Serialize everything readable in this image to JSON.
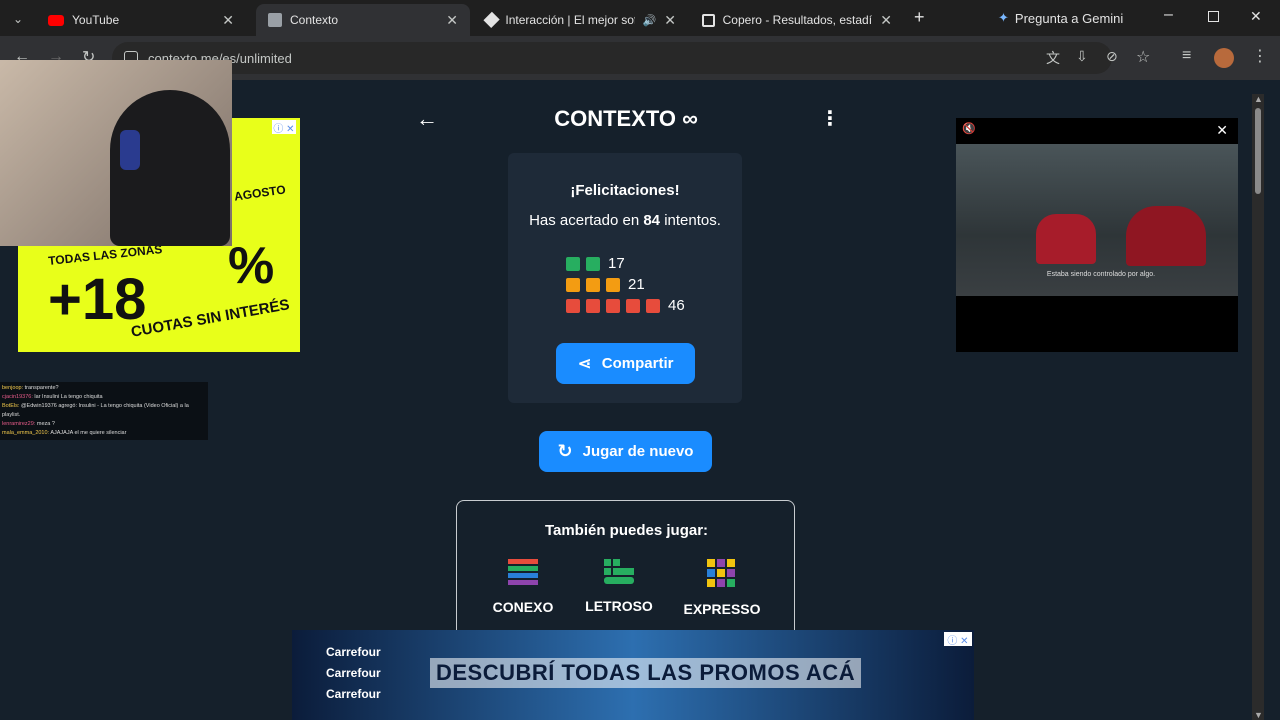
{
  "tabs": [
    {
      "title": "YouTube",
      "icon": "youtube-icon"
    },
    {
      "title": "Contexto",
      "icon": "contexto-favicon-icon"
    },
    {
      "title": "Interacción | El mejor softw",
      "icon": "tab-app-icon"
    },
    {
      "title": "Copero - Resultados, estadístic",
      "icon": "tab-app-icon"
    }
  ],
  "gemini_label": "Pregunta a Gemini",
  "url": "contexto.me/es/unlimited",
  "header": {
    "title": "CONTEXTO ∞"
  },
  "result": {
    "heading": "¡Felicitaciones!",
    "summary_prefix": "Has acertado en ",
    "attempts": "84",
    "summary_suffix": " intentos.",
    "rows": [
      {
        "count": "17",
        "squares": 2,
        "color": "#27ae60"
      },
      {
        "count": "21",
        "squares": 3,
        "color": "#f39c12"
      },
      {
        "count": "46",
        "squares": 5,
        "color": "#e74c3c"
      }
    ],
    "share_label": "Compartir"
  },
  "play_again_label": "Jugar de nuevo",
  "also_play": {
    "heading": "También puedes jugar:",
    "games": [
      {
        "name": "CONEXO"
      },
      {
        "name": "LETROSO"
      },
      {
        "name": "EXPRESSO"
      }
    ]
  },
  "bottom_ad": {
    "brand_lines": [
      "Carrefour",
      "Carrefour",
      "Carrefour"
    ],
    "headline": "DESCUBRÍ TODAS LAS PROMOS ACÁ"
  },
  "left_ad": {
    "big": "+18",
    "text1": "CUOTAS SIN INTERÉS",
    "text2": "TODAS LAS ZONAS",
    "text3": "AGOSTO"
  },
  "video_subtitle": "Estaba siendo controlado por algo.",
  "chat": [
    {
      "user": "benjoop",
      "msg": "transparente?"
    },
    {
      "user": "cjacin19376",
      "msg": "lar Insulini La tengo chiquita"
    },
    {
      "user": "BotEls",
      "msg": "@Edwin19376 agregó: Insulini - La tengo chiquita (Video Oficial) a la playlist."
    },
    {
      "user": "lenramirez29",
      "msg": "meza ?"
    },
    {
      "user": "mala_emma_2010",
      "msg": "AJAJAJA el me quiere silenciar"
    }
  ]
}
